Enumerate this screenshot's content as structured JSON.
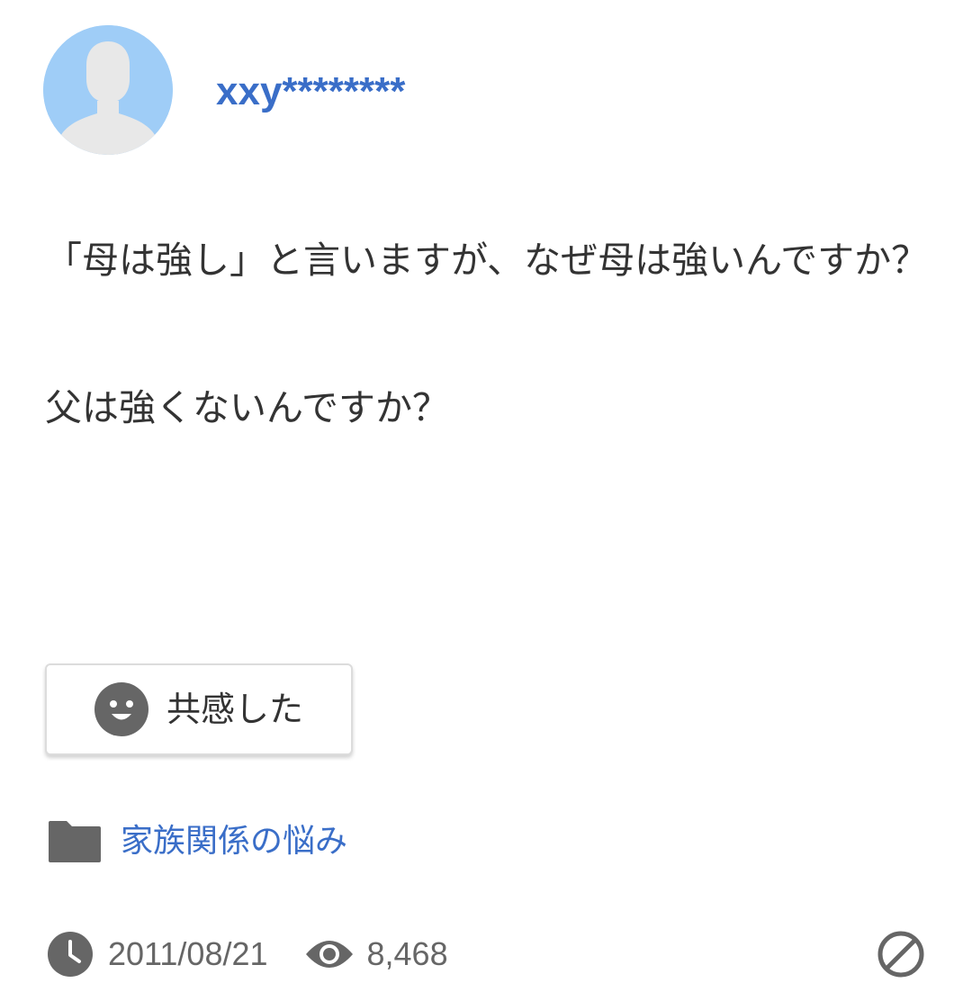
{
  "post": {
    "username": "xxy********",
    "question_lines": [
      "「母は強し」と言いますが、なぜ母は強いんですか？",
      "父は強くないんですか？"
    ]
  },
  "actions": {
    "empathy_label": "共感した"
  },
  "category": {
    "label": "家族関係の悩み"
  },
  "meta": {
    "date": "2011/08/21",
    "views": "8,468"
  },
  "icons": {
    "avatar": "default-user-icon",
    "empathy": "smiley-face-icon",
    "category": "folder-icon",
    "date": "clock-icon",
    "views": "eye-icon",
    "report": "prohibited-icon"
  },
  "colors": {
    "link": "#3a6ec8",
    "avatar_bg": "#9fcdf7",
    "icon_gray": "#666666",
    "text": "#333333"
  }
}
